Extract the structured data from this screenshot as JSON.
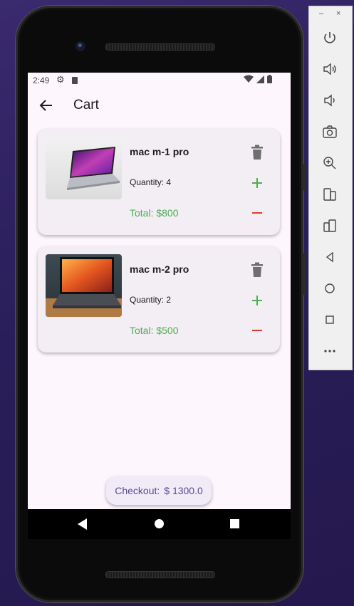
{
  "status": {
    "time": "2:49"
  },
  "app": {
    "title": "Cart"
  },
  "cart": {
    "items": [
      {
        "name": "mac m-1 pro",
        "quantity": "Quantity: 4",
        "total": "Total: $800"
      },
      {
        "name": "mac m-2 pro",
        "quantity": "Quantity: 2",
        "total": "Total: $500"
      }
    ],
    "checkout_label": "Checkout:",
    "checkout_amount": "$ 1300.0"
  },
  "emulator": {
    "minimize": "–",
    "close": "×"
  },
  "colors": {
    "accent": "#5b4a8f",
    "total": "#4caf50",
    "plus": "#4caf50",
    "minus": "#e53935",
    "screen_bg": "#fdf6fd"
  }
}
